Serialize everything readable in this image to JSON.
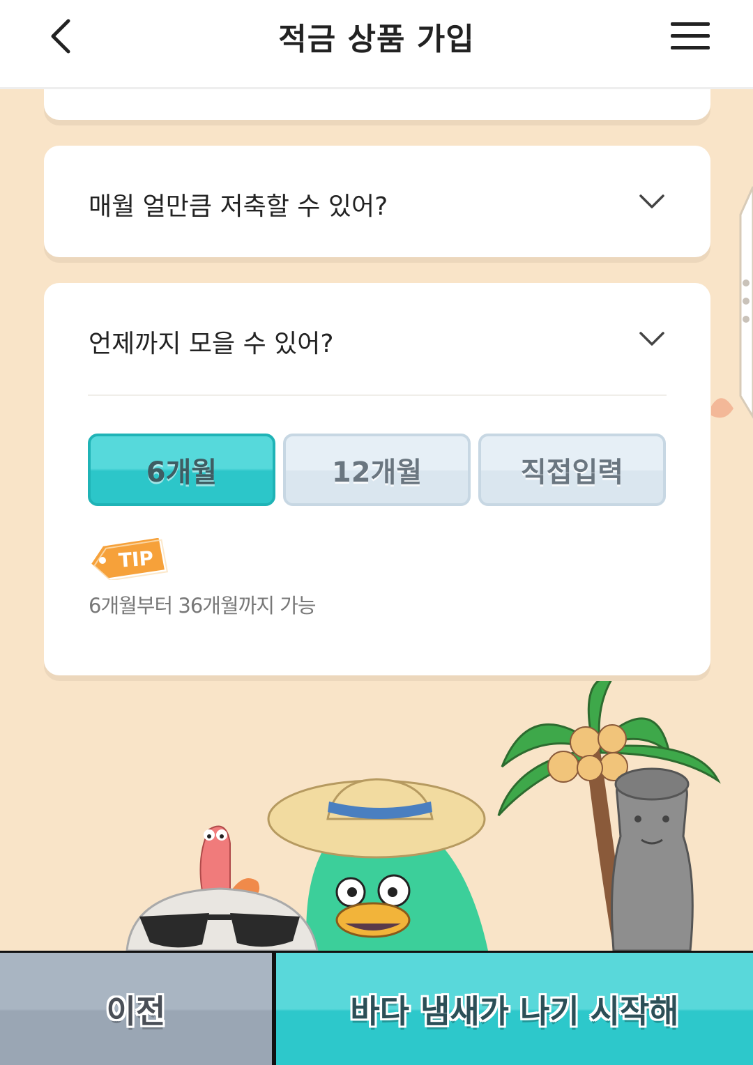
{
  "header": {
    "title": "적금 상품 가입",
    "back_icon": "chevron-left-icon",
    "menu_icon": "hamburger-menu-icon"
  },
  "questions": {
    "monthly": {
      "label": "매월 얼만큼 저축할 수 있어?",
      "expanded": false
    },
    "period": {
      "label": "언제까지 모을 수 있어?",
      "expanded": true
    }
  },
  "period_options": [
    {
      "label": "6개월",
      "selected": true
    },
    {
      "label": "12개월",
      "selected": false
    },
    {
      "label": "직접입력",
      "selected": false
    }
  ],
  "tip": {
    "tag": "TIP",
    "text": "6개월부터 36개월까지 가능"
  },
  "buttons": {
    "prev": "이전",
    "next": "바다 냄새가 나기 시작해"
  },
  "colors": {
    "accent": "#2cc6c9",
    "background": "#f9e4c8",
    "tip_tag": "#f6a13a",
    "inactive": "#dae6ef"
  }
}
